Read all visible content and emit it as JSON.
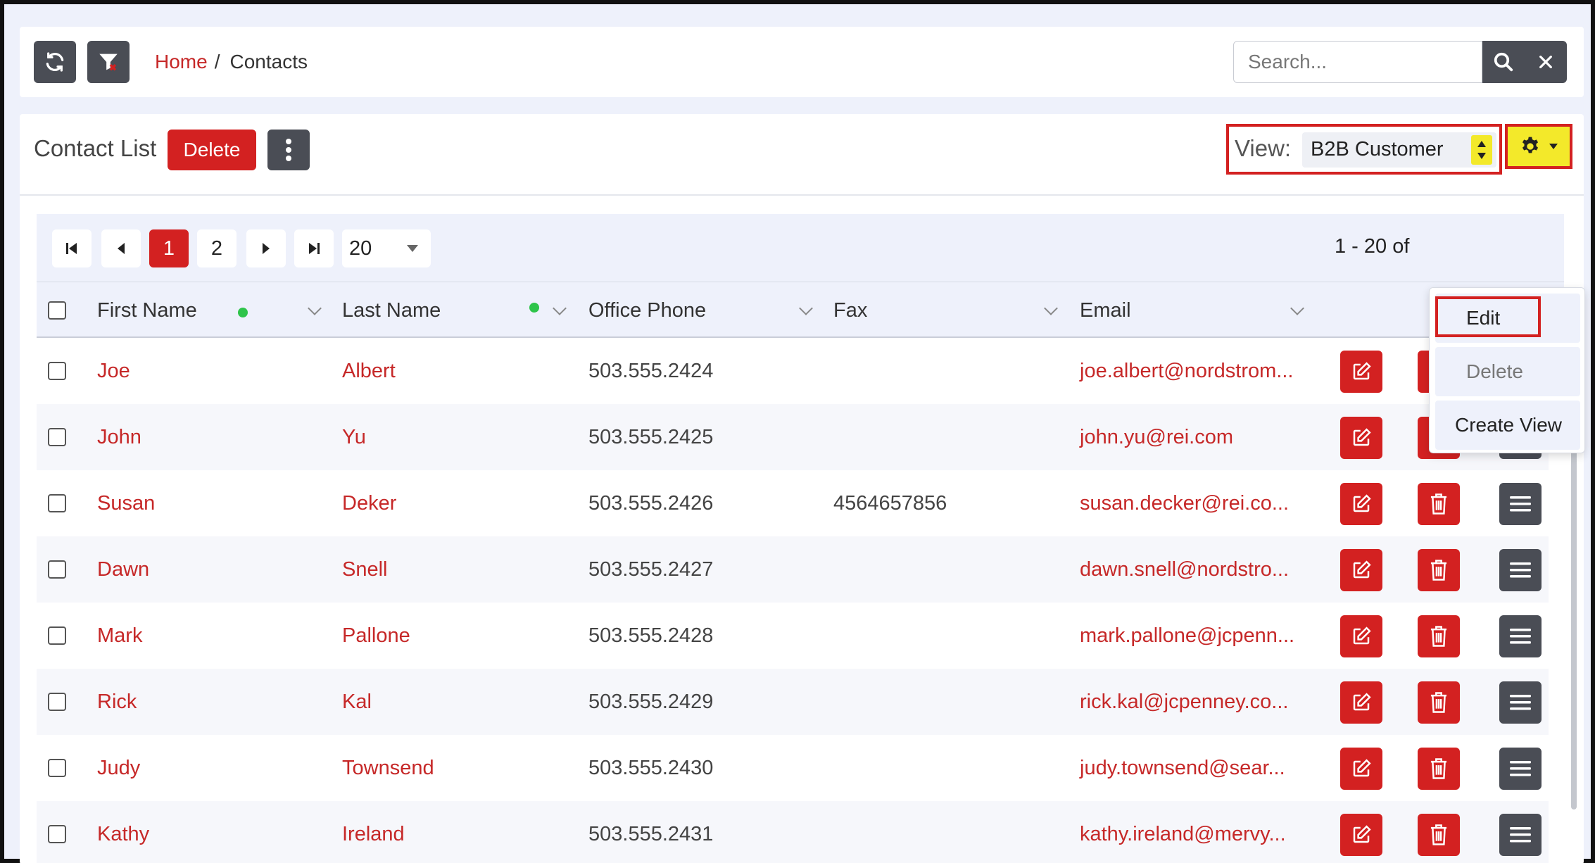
{
  "colors": {
    "accent": "#d32121",
    "link": "#c62828",
    "dark": "#4a4d55",
    "highlight": "#f3e92a",
    "dot": "#2ec44a"
  },
  "breadcrumb": {
    "home": "Home",
    "separator": "/",
    "current": "Contacts"
  },
  "search": {
    "placeholder": "Search..."
  },
  "header": {
    "title": "Contact List",
    "delete_label": "Delete",
    "view_label": "View:",
    "view_value": "B2B Customer"
  },
  "settings_menu": {
    "items": [
      "Edit",
      "Delete",
      "Create View"
    ]
  },
  "pager": {
    "pages": [
      "1",
      "2"
    ],
    "active_page": "1",
    "page_size": "20",
    "info": "1 - 20 of"
  },
  "columns": [
    "First Name",
    "Last Name",
    "Office Phone",
    "Fax",
    "Email"
  ],
  "rows": [
    {
      "first": "Joe",
      "last": "Albert",
      "phone": "503.555.2424",
      "fax": "",
      "email": "joe.albert@nordstrom..."
    },
    {
      "first": "John",
      "last": "Yu",
      "phone": "503.555.2425",
      "fax": "",
      "email": "john.yu@rei.com"
    },
    {
      "first": "Susan",
      "last": "Deker",
      "phone": "503.555.2426",
      "fax": "4564657856",
      "email": "susan.decker@rei.co..."
    },
    {
      "first": "Dawn",
      "last": "Snell",
      "phone": "503.555.2427",
      "fax": "",
      "email": "dawn.snell@nordstro..."
    },
    {
      "first": "Mark",
      "last": "Pallone",
      "phone": "503.555.2428",
      "fax": "",
      "email": "mark.pallone@jcpenn..."
    },
    {
      "first": "Rick",
      "last": "Kal",
      "phone": "503.555.2429",
      "fax": "",
      "email": "rick.kal@jcpenney.co..."
    },
    {
      "first": "Judy",
      "last": "Townsend",
      "phone": "503.555.2430",
      "fax": "",
      "email": "judy.townsend@sear..."
    },
    {
      "first": "Kathy",
      "last": "Ireland",
      "phone": "503.555.2431",
      "fax": "",
      "email": "kathy.ireland@mervy..."
    }
  ]
}
